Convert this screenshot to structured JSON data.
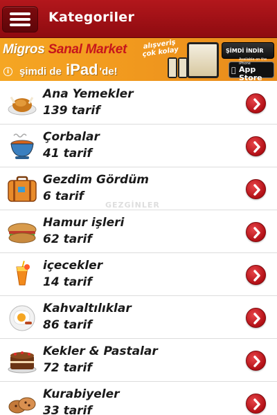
{
  "header": {
    "title": "Kategoriler",
    "menu_icon": "hamburger-menu-icon",
    "bg_color": "#a3141a"
  },
  "banner": {
    "brand_white": "Migros",
    "brand_red": " Sanal Market",
    "line_prefix": "şimdi de",
    "line_ipad": "iPad",
    "line_suffix": "'de!",
    "slogan": "alışveriş çok kolay",
    "download_label": "ŞİMDİ İNDİR",
    "appstore_small": "Available on the iPhone",
    "appstore_big": "App Store"
  },
  "categories": [
    {
      "title": "Ana Yemekler",
      "count": "139 tarif",
      "icon": "roast-chicken-icon"
    },
    {
      "title": "Çorbalar",
      "count": "41 tarif",
      "icon": "soup-bowl-icon"
    },
    {
      "title": "Gezdim Gördüm",
      "count": "6 tarif",
      "icon": "suitcase-icon"
    },
    {
      "title": "Hamur işleri",
      "count": "62 tarif",
      "icon": "sandwich-icon"
    },
    {
      "title": "içecekler",
      "count": "14 tarif",
      "icon": "cocktail-icon"
    },
    {
      "title": "Kahvaltılıklar",
      "count": "86 tarif",
      "icon": "fried-egg-icon"
    },
    {
      "title": "Kekler & Pastalar",
      "count": "72 tarif",
      "icon": "cake-icon"
    },
    {
      "title": "Kurabiyeler",
      "count": "33 tarif",
      "icon": "cookies-icon"
    }
  ],
  "watermark": "GEZGİNLER",
  "colors": {
    "accent": "#b10f15",
    "banner": "#f29b1f"
  }
}
